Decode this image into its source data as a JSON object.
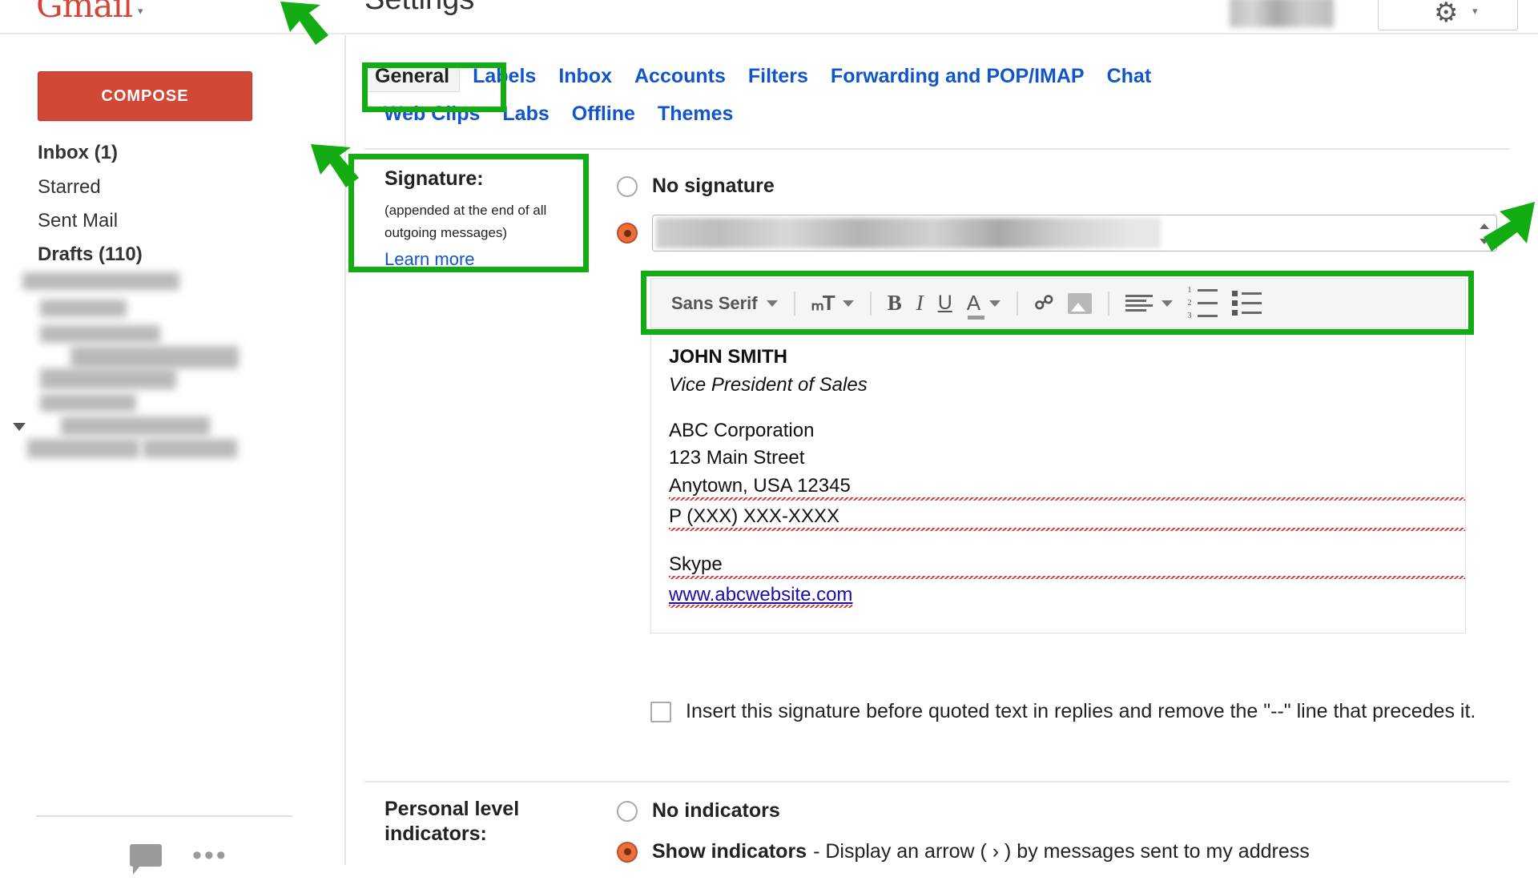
{
  "header": {
    "logo": "Gmail",
    "logo_caret": "▾",
    "title": "Settings",
    "gear_icon": "gear-icon",
    "gear_caret": "▾"
  },
  "sidebar": {
    "compose_label": "COMPOSE",
    "items": [
      {
        "label": "Inbox (1)",
        "bold": true
      },
      {
        "label": "Starred",
        "bold": false
      },
      {
        "label": "Sent Mail",
        "bold": false
      },
      {
        "label": "Drafts (110)",
        "bold": true
      }
    ],
    "footer_icons": [
      "chat-icon",
      "more-icon"
    ],
    "more_glyph": "•••"
  },
  "tabs": {
    "row1": [
      {
        "label": "General",
        "active": true
      },
      {
        "label": "Labels",
        "active": false
      },
      {
        "label": "Inbox",
        "active": false
      },
      {
        "label": "Accounts",
        "active": false
      },
      {
        "label": "Filters",
        "active": false
      },
      {
        "label": "Forwarding and POP/IMAP",
        "active": false
      },
      {
        "label": "Chat",
        "active": false
      }
    ],
    "row2": [
      {
        "label": "Web Clips",
        "active": false
      },
      {
        "label": "Labs",
        "active": false
      },
      {
        "label": "Offline",
        "active": false
      },
      {
        "label": "Themes",
        "active": false
      }
    ]
  },
  "signature_section": {
    "label": "Signature:",
    "sublabel": "(appended at the end of all outgoing messages)",
    "learn_more": "Learn more",
    "no_signature_label": "No signature",
    "no_signature_selected": false,
    "signature_selected": true,
    "address_select_value": "",
    "toolbar": {
      "font_name": "Sans Serif",
      "icons": [
        "font-family-dropdown",
        "text-size-icon",
        "bold-icon",
        "italic-icon",
        "underline-icon",
        "text-color-icon",
        "link-icon",
        "insert-image-icon",
        "align-icon",
        "numbered-list-icon",
        "bulleted-list-icon"
      ]
    },
    "content": {
      "name": "JOHN SMITH",
      "title": "Vice President of Sales",
      "company": "ABC Corporation",
      "street": "123 Main Street",
      "city_state_zip": "Anytown, USA 12345",
      "phone": "P (XXX) XXX-XXXX",
      "skype": "Skype",
      "website": "www.abcwebsite.com"
    },
    "insert_before_quoted_label": "Insert this signature before quoted text in replies and remove the \"--\" line that precedes it.",
    "insert_before_quoted_checked": false
  },
  "personal_level": {
    "label_line1": "Personal level",
    "label_line2": "indicators:",
    "no_indicators_label": "No indicators",
    "no_indicators_selected": false,
    "show_indicators_label": "Show indicators",
    "show_indicators_desc": "- Display an arrow ( › ) by messages sent to my address",
    "show_indicators_selected": true
  },
  "annotations": {
    "highlight_color": "#13ad13",
    "boxes": [
      "general-tab",
      "signature-label",
      "formatting-toolbar"
    ],
    "arrows": [
      "arrow-to-general-tab",
      "arrow-to-signature-label",
      "arrow-to-toolbar"
    ]
  },
  "colors": {
    "compose_red": "#d14836",
    "link_blue": "#1155cc",
    "gmail_red": "#d44638",
    "radio_orange": "#e8703a",
    "annotation_green": "#13ad13"
  }
}
